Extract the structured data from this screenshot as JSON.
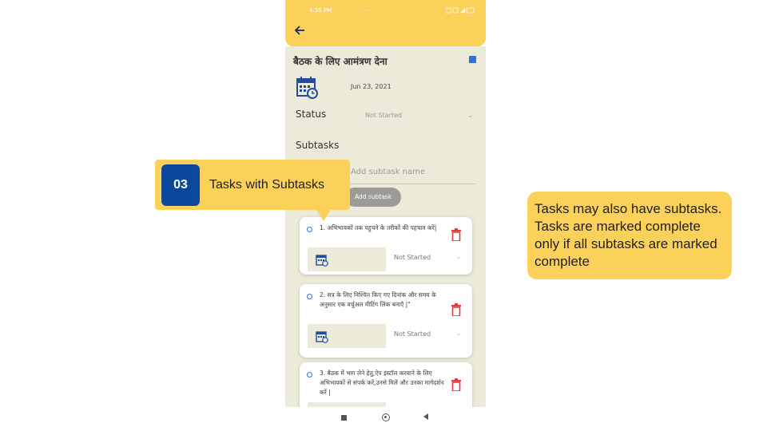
{
  "status_bar": {
    "time": "4:35 PM",
    "dots": "···"
  },
  "app_bar": {
    "back_icon": "back-arrow-icon"
  },
  "task": {
    "title": "बैठक के लिए आमंत्रण देना",
    "date": "Jun 23, 2021",
    "status_label": "Status",
    "status_value": "Not Started"
  },
  "subtasks": {
    "label": "Subtasks",
    "input_placeholder": "Add subtask name",
    "add_button": "Add subtask",
    "items": [
      {
        "text": "1. अभिभावकों तक पहुचने के तरीकों की पहचान करें|",
        "status": "Not Started"
      },
      {
        "text": "2. सत्र के लिए निश्चित किए गए दिनांक और समय के अनुसार एक वर्चुअल मीटिंग लिंक बनाएँ |\"",
        "status": "Not Started"
      },
      {
        "text": "3. बैठक में भाग लेने हेतु,ऐप इंस्टॉल करवाने के लिए अभिभावकों से संपर्क करें,उनसे मिलें और उनका मार्गदर्शन करें |",
        "status": ""
      }
    ]
  },
  "callout_step": {
    "number": "03",
    "label": "Tasks with Subtasks"
  },
  "callout_info": {
    "text": "Tasks may also have subtasks. Tasks are marked complete only if all subtasks are marked complete"
  },
  "colors": {
    "accent_yellow": "#fcd15a",
    "badge_blue": "#0b479a",
    "delete_red": "#e53935",
    "panel_beige": "#ecead9"
  }
}
